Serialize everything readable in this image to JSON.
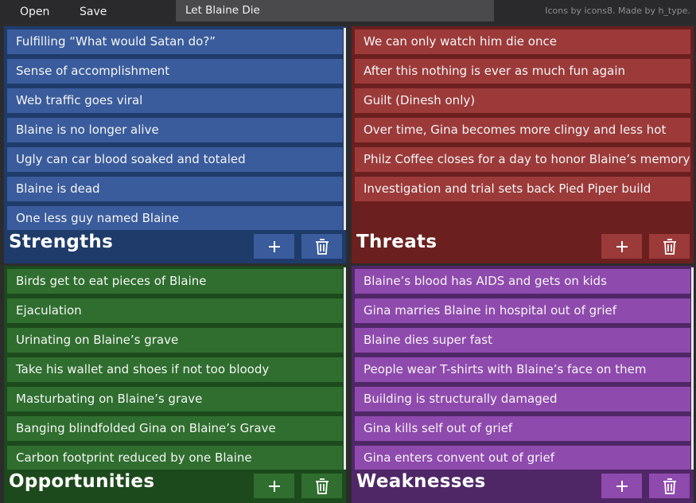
{
  "toolbar": {
    "open_label": "Open",
    "save_label": "Save"
  },
  "document": {
    "title": "Let Blaine Die"
  },
  "credits": "Icons by icons8. Made by h_type.",
  "colors": {
    "strengths_bg": "#1f3b6a",
    "strengths_item": "#3a5c9c",
    "threats_bg": "#6b1f1f",
    "threats_item": "#9c3a3a",
    "opportunities_bg": "#1c4a1c",
    "opportunities_item": "#2f6e2f",
    "weaknesses_bg": "#4f2766",
    "weaknesses_item": "#8f4aae"
  },
  "icons": {
    "add": "plus-icon",
    "delete": "trash-icon"
  },
  "strengths": {
    "title": "Strengths",
    "items": [
      "Fulfilling “What would Satan do?”",
      "Sense of accomplishment",
      "Web traffic goes viral",
      "Blaine is no longer alive",
      "Ugly can car blood soaked and totaled",
      "Blaine is dead",
      "One less guy named Blaine"
    ]
  },
  "threats": {
    "title": "Threats",
    "items": [
      "We can only watch him die once",
      "After this nothing is ever as much fun again",
      "Guilt (Dinesh only)",
      "Over time, Gina becomes more clingy and less hot",
      "Philz Coffee closes for a day to honor Blaine’s memory",
      "Investigation and trial sets back Pied Piper build"
    ]
  },
  "opportunities": {
    "title": "Opportunities",
    "items": [
      "Birds get to eat pieces of Blaine",
      "Ejaculation",
      "Urinating on Blaine’s grave",
      "Take his wallet and shoes if not too bloody",
      "Masturbating on Blaine’s grave",
      "Banging blindfolded Gina on Blaine’s Grave",
      "Carbon footprint reduced by one Blaine"
    ]
  },
  "weaknesses": {
    "title": "Weaknesses",
    "items": [
      "Blaine’s blood has AIDS and gets on kids",
      "Gina marries Blaine in hospital out of grief",
      "Blaine dies super fast",
      "People wear T-shirts with Blaine’s face on them",
      "Building is structurally damaged",
      "Gina kills self out of grief",
      "Gina enters convent out of grief"
    ]
  }
}
